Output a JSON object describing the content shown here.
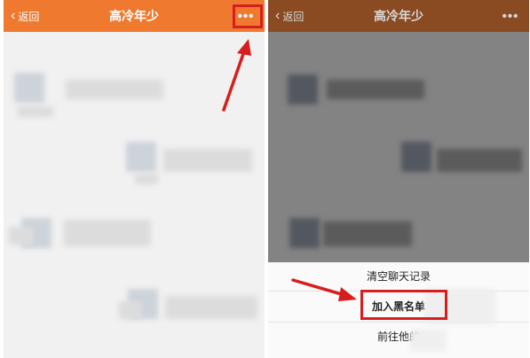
{
  "left_screen": {
    "back_label": "返回",
    "title": "高冷年少",
    "more_label": "•••"
  },
  "right_screen": {
    "back_label": "返回",
    "title": "高冷年少",
    "more_label": "•••",
    "action_sheet": [
      {
        "label": "清空聊天记录"
      },
      {
        "label": "加入黑名单"
      },
      {
        "label": "前往他的"
      }
    ]
  },
  "colors": {
    "navbar": "#ef7a2f",
    "highlight": "#d61e1e",
    "overlay": "#555555"
  }
}
